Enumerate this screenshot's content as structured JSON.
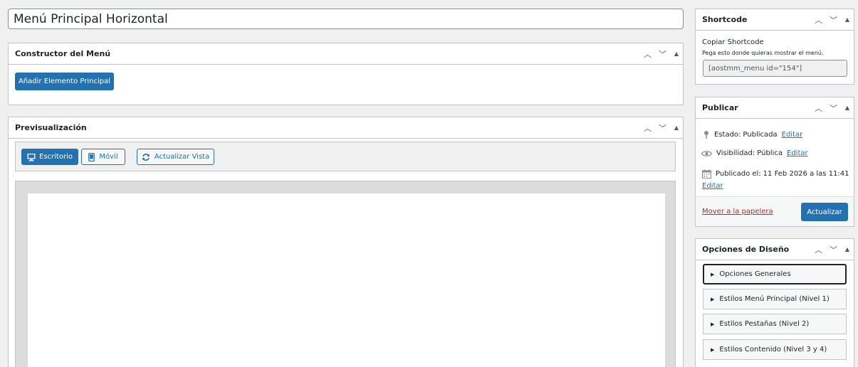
{
  "title_value": "Menú Principal Horizontal",
  "builder": {
    "title": "Constructor del Menú",
    "add_button": "Añadir Elemento Principal"
  },
  "preview": {
    "title": "Previsualización",
    "desktop": "Escritorio",
    "mobile": "Móvil",
    "refresh": "Actualizar Vista"
  },
  "shortcode": {
    "title": "Shortcode",
    "copy_label": "Copiar Shortcode",
    "hint": "Pega esto donde quieras mostrar el menú.",
    "value": "[aostmm_menu id=\"154\"]"
  },
  "publish": {
    "title": "Publicar",
    "status_label": "Estado:",
    "status_value": "Publicada",
    "visibility_label": "Visibilidad:",
    "visibility_value": "Pública",
    "published_label": "Publicado el:",
    "published_value": "11 Feb 2026 a las 11:41",
    "edit": "Editar",
    "trash": "Mover a la papelera",
    "update": "Actualizar"
  },
  "design": {
    "title": "Opciones de Diseño",
    "sections": [
      "Opciones Generales",
      "Estilos Menú Principal (Nivel 1)",
      "Estilos Pestañas (Nivel 2)",
      "Estilos Contenido (Nivel 3 y 4)"
    ]
  },
  "icons": {
    "up": "chevron-up-icon",
    "down": "chevron-down-icon",
    "toggle": "triangle-up-icon",
    "desktop": "desktop-icon",
    "mobile": "smartphone-icon",
    "refresh": "update-icon",
    "status": "pin-icon",
    "visibility": "eye-icon",
    "calendar": "calendar-icon"
  },
  "colors": {
    "primary": "#2271b1",
    "danger": "#b32d2e",
    "background": "#f0f0f1"
  }
}
